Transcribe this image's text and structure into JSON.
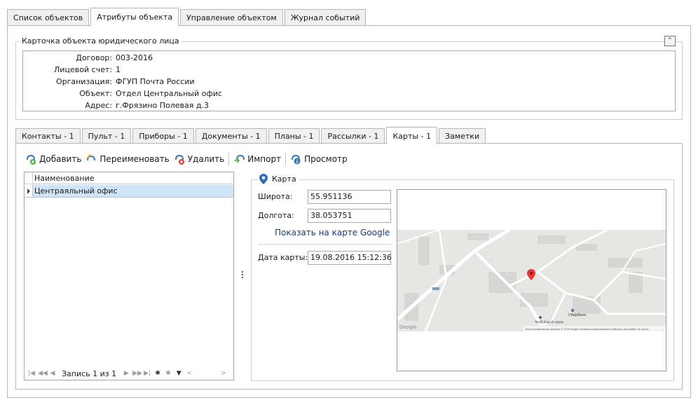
{
  "top_tabs": [
    "Список объектов",
    "Атрибуты объекта",
    "Управление объектом",
    "Журнал событий"
  ],
  "card": {
    "title": "Карточка объекта юридического лица",
    "fields": [
      {
        "label": "Договор:",
        "value": "003-2016"
      },
      {
        "label": "Лицевой счет:",
        "value": "1"
      },
      {
        "label": "Организация:",
        "value": "ФГУП Почта России"
      },
      {
        "label": "Объект:",
        "value": "Отдел Центральный офис"
      },
      {
        "label": "Адрес:",
        "value": "г.Фрязино Полевая д.3"
      }
    ]
  },
  "inner_tabs": [
    "Контакты - 1",
    "Пульт - 1",
    "Приборы - 1",
    "Документы - 1",
    "Планы - 1",
    "Рассылки - 1",
    "Карты - 1",
    "Заметки"
  ],
  "toolbar": {
    "add": "Добавить",
    "rename": "Переименовать",
    "delete": "Удалить",
    "import": "Импорт",
    "view": "Просмотр"
  },
  "grid": {
    "column": "Наименование",
    "rows": [
      "Центраяльный офис"
    ],
    "nav_text": "Запись 1 из 1"
  },
  "map_panel": {
    "title": "Карта",
    "lat_label": "Широта:",
    "lat_value": "55.951136",
    "lon_label": "Долгота:",
    "lon_value": "38.053751",
    "link": "Показать на карте Google",
    "date_label": "Дата карты:",
    "date_value": "19.08.2016 15:12:36"
  },
  "map_labels": {
    "bank": "Сбербанк",
    "courses": "Yes26 English курсы",
    "google": "Google",
    "footer": "Картографические данные © 2016 Google   Условия использования   Сообщить об ошибке на карте"
  }
}
